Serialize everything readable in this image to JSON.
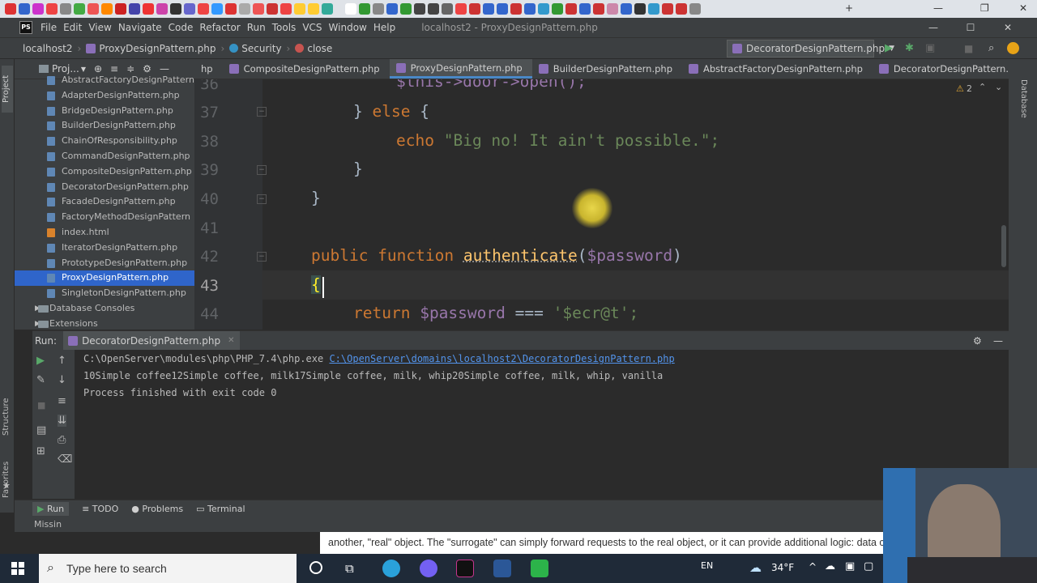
{
  "menu": {
    "logo": "PS",
    "items": [
      "File",
      "Edit",
      "View",
      "Navigate",
      "Code",
      "Refactor",
      "Run",
      "Tools",
      "VCS",
      "Window",
      "Help"
    ],
    "window_title": "localhost2 - ProxyDesignPattern.php"
  },
  "navbar": {
    "crumbs": [
      "localhost2",
      "ProxyDesignPattern.php",
      "Security",
      "close"
    ],
    "run_config": "DecoratorDesignPattern.php"
  },
  "project": {
    "label": "Proj...",
    "files": [
      "AbstractFactoryDesignPattern",
      "AdapterDesignPattern.php",
      "BridgeDesignPattern.php",
      "BuilderDesignPattern.php",
      "ChainOfResponsibility.php",
      "CommandDesignPattern.php",
      "CompositeDesignPattern.php",
      "DecoratorDesignPattern.php",
      "FacadeDesignPattern.php",
      "FactoryMethodDesignPattern",
      "index.html",
      "IteratorDesignPattern.php",
      "PrototypeDesignPattern.php",
      "ProxyDesignPattern.php",
      "SingletonDesignPattern.php"
    ],
    "folders": [
      "Database Consoles",
      "Extensions"
    ]
  },
  "editor_tabs": [
    "hp",
    "CompositeDesignPattern.php",
    "ProxyDesignPattern.php",
    "BuilderDesignPattern.php",
    "AbstractFactoryDesignPattern.php",
    "DecoratorDesignPattern.php"
  ],
  "editor": {
    "warnings": "2",
    "line_numbers": [
      "36",
      "37",
      "38",
      "39",
      "40",
      "41",
      "42",
      "43",
      "44"
    ],
    "lines": {
      "l36": "$this->door->open();",
      "l37_kw": "else",
      "l38_echo": "echo",
      "l38_str": "\"Big no! It ain't possible.\";",
      "l42_kw": "public function",
      "l42_fn": "authenticate",
      "l42_param": "$password",
      "l43": "{",
      "l44_kw": "return",
      "l44_var": "$password",
      "l44_op": "===",
      "l44_str": "'$ecr@t';"
    }
  },
  "run": {
    "label": "Run:",
    "tab": "DecoratorDesignPattern.php",
    "cmd": "C:\\OpenServer\\modules\\php\\PHP_7.4\\php.exe",
    "cmd_link": "C:\\OpenServer\\domains\\localhost2\\DecoratorDesignPattern.php",
    "output": "10Simple coffee12Simple coffee, milk17Simple coffee, milk, whip20Simple coffee, milk, whip, vanilla",
    "exit": "Process finished with exit code 0"
  },
  "tool_tabs": [
    "Run",
    "TODO",
    "Problems",
    "Terminal"
  ],
  "side_labels": {
    "structure": "Structure",
    "favorites": "Favorites",
    "project": "Project",
    "database": "Database"
  },
  "status": "Missin",
  "web_text": "another, \"real\" object. The \"surrogate\" can simply forward requests to the real object, or it can provide additional logic: data caching",
  "taskbar": {
    "search_placeholder": "Type here to search",
    "lang": "EN",
    "temp": "34°F"
  },
  "colors": {
    "accent": "#2f65ca",
    "keyword": "#cc7832",
    "string": "#6a8759",
    "variable": "#9876aa",
    "function": "#ffc66d"
  }
}
